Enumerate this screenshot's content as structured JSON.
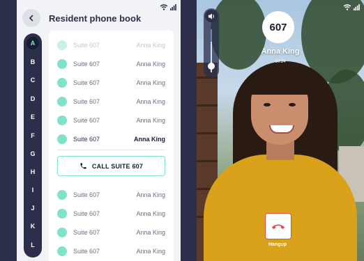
{
  "phonebook": {
    "title": "Resident phone book",
    "letters": [
      "A",
      "B",
      "C",
      "D",
      "E",
      "F",
      "G",
      "H",
      "I",
      "J",
      "K",
      "L"
    ],
    "active_letter": "A",
    "rows_top": [
      {
        "suite": "Suite 607",
        "name": "Anna King",
        "state": "faded"
      },
      {
        "suite": "Suite 607",
        "name": "Anna King",
        "state": "normal"
      },
      {
        "suite": "Suite 607",
        "name": "Anna King",
        "state": "normal"
      },
      {
        "suite": "Suite 607",
        "name": "Anna King",
        "state": "normal"
      },
      {
        "suite": "Suite 607",
        "name": "Anna King",
        "state": "normal"
      },
      {
        "suite": "Suite 607",
        "name": "Anna King",
        "state": "selected"
      }
    ],
    "call_button": "CALL SUITE 607",
    "rows_bottom": [
      {
        "suite": "Suite 607",
        "name": "Anna King",
        "state": "normal"
      },
      {
        "suite": "Suite 607",
        "name": "Anna King",
        "state": "normal"
      },
      {
        "suite": "Suite 607",
        "name": "Anna King",
        "state": "normal"
      },
      {
        "suite": "Suite 607",
        "name": "Anna King",
        "state": "normal"
      }
    ]
  },
  "call": {
    "suite_number": "607",
    "caller_name": "Anna King",
    "timer": "00:24",
    "hangup_label": "Hangup",
    "volume_level": 0.7
  },
  "colors": {
    "accent": "#7ee3c8",
    "dark": "#2b2f4a",
    "danger": "#e34b4b"
  }
}
